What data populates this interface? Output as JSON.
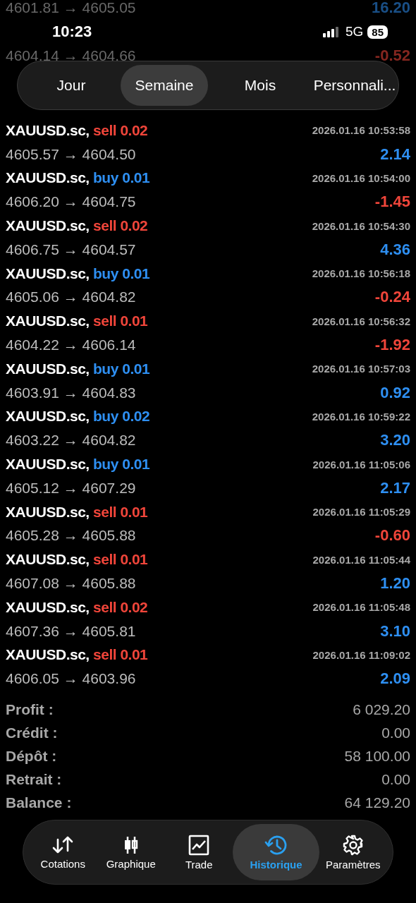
{
  "background_rows": [
    {
      "prices": "4601.81 → 4605.05",
      "profit": "16.20",
      "negative": false
    },
    {
      "prices": "4604.14 → 4604.66",
      "profit": "-0.52",
      "negative": true
    }
  ],
  "status_bar": {
    "time": "10:23",
    "network": "5G",
    "battery": "85"
  },
  "period_tabs": [
    {
      "label": "Jour",
      "selected": false
    },
    {
      "label": "Semaine",
      "selected": true
    },
    {
      "label": "Mois",
      "selected": false
    },
    {
      "label": "Personnali...",
      "selected": false
    }
  ],
  "trades": [
    {
      "symbol": "XAUUSD.sc,",
      "buy": false,
      "volume": "sell 0.02",
      "time": "2026.01.16 10:53:58",
      "prices": "4605.57 → 4604.50",
      "profit": "2.14",
      "negative": false
    },
    {
      "symbol": "XAUUSD.sc,",
      "buy": true,
      "volume": "buy 0.01",
      "time": "2026.01.16 10:54:00",
      "prices": "4606.20 → 4604.75",
      "profit": "-1.45",
      "negative": true
    },
    {
      "symbol": "XAUUSD.sc,",
      "buy": false,
      "volume": "sell 0.02",
      "time": "2026.01.16 10:54:30",
      "prices": "4606.75 → 4604.57",
      "profit": "4.36",
      "negative": false
    },
    {
      "symbol": "XAUUSD.sc,",
      "buy": true,
      "volume": "buy 0.01",
      "time": "2026.01.16 10:56:18",
      "prices": "4605.06 → 4604.82",
      "profit": "-0.24",
      "negative": true
    },
    {
      "symbol": "XAUUSD.sc,",
      "buy": false,
      "volume": "sell 0.01",
      "time": "2026.01.16 10:56:32",
      "prices": "4604.22 → 4606.14",
      "profit": "-1.92",
      "negative": true
    },
    {
      "symbol": "XAUUSD.sc,",
      "buy": true,
      "volume": "buy 0.01",
      "time": "2026.01.16 10:57:03",
      "prices": "4603.91 → 4604.83",
      "profit": "0.92",
      "negative": false
    },
    {
      "symbol": "XAUUSD.sc,",
      "buy": true,
      "volume": "buy 0.02",
      "time": "2026.01.16 10:59:22",
      "prices": "4603.22 → 4604.82",
      "profit": "3.20",
      "negative": false
    },
    {
      "symbol": "XAUUSD.sc,",
      "buy": true,
      "volume": "buy 0.01",
      "time": "2026.01.16 11:05:06",
      "prices": "4605.12 → 4607.29",
      "profit": "2.17",
      "negative": false
    },
    {
      "symbol": "XAUUSD.sc,",
      "buy": false,
      "volume": "sell 0.01",
      "time": "2026.01.16 11:05:29",
      "prices": "4605.28 → 4605.88",
      "profit": "-0.60",
      "negative": true
    },
    {
      "symbol": "XAUUSD.sc,",
      "buy": false,
      "volume": "sell 0.01",
      "time": "2026.01.16 11:05:44",
      "prices": "4607.08 → 4605.88",
      "profit": "1.20",
      "negative": false
    },
    {
      "symbol": "XAUUSD.sc,",
      "buy": false,
      "volume": "sell 0.02",
      "time": "2026.01.16 11:05:48",
      "prices": "4607.36 → 4605.81",
      "profit": "3.10",
      "negative": false
    },
    {
      "symbol": "XAUUSD.sc,",
      "buy": false,
      "volume": "sell 0.01",
      "time": "2026.01.16 11:09:02",
      "prices": "4606.05 → 4603.96",
      "profit": "2.09",
      "negative": false
    }
  ],
  "summary": [
    {
      "label": "Profit :",
      "value": "6 029.20"
    },
    {
      "label": "Crédit :",
      "value": "0.00"
    },
    {
      "label": "Dépôt :",
      "value": "58 100.00"
    },
    {
      "label": "Retrait :",
      "value": "0.00"
    },
    {
      "label": "Balance :",
      "value": "64 129.20"
    }
  ],
  "tab_bar": [
    {
      "kind": "quotes",
      "label": "Cotations",
      "selected": false
    },
    {
      "kind": "chart",
      "label": "Graphique",
      "selected": false
    },
    {
      "kind": "trade",
      "label": "Trade",
      "selected": false
    },
    {
      "kind": "history",
      "label": "Historique",
      "selected": true
    },
    {
      "kind": "settings",
      "label": "Paramètres",
      "selected": false
    }
  ]
}
